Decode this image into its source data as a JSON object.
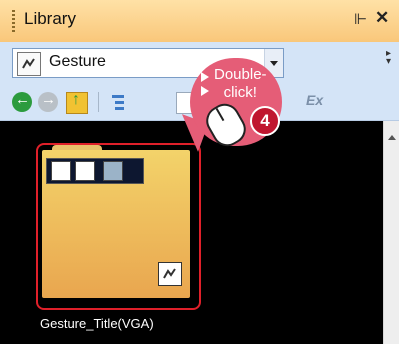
{
  "panel": {
    "title": "Library"
  },
  "combo": {
    "value": "Gesture"
  },
  "toolbar": {
    "ex_label": "Ex"
  },
  "item": {
    "label": "Gesture_Title(VGA)"
  },
  "callout": {
    "line1": "Double-",
    "line2": "click!",
    "step": "4"
  },
  "colors": {
    "accent": "#e55d77",
    "frame": "#e0202a",
    "titlebar": "#f9c77a"
  },
  "icons": [
    "pin-icon",
    "close-icon",
    "back-icon",
    "forward-icon",
    "up-folder-icon",
    "tree-icon",
    "mouse-icon"
  ]
}
